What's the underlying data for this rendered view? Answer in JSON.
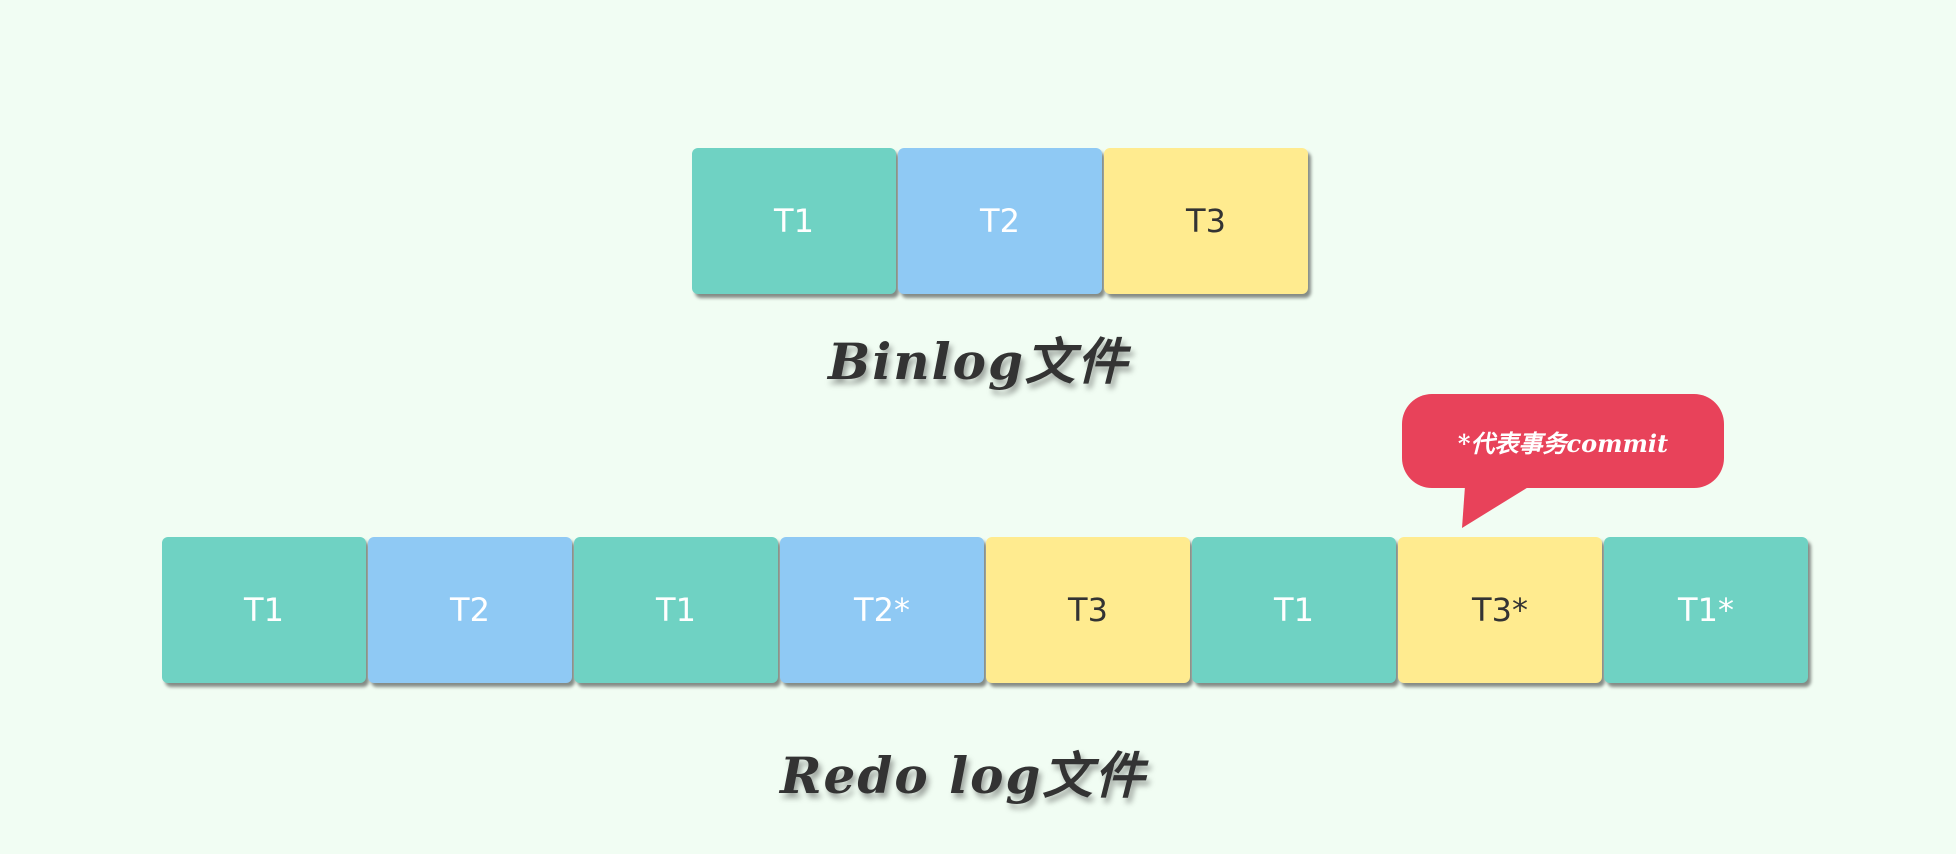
{
  "binlog": {
    "blocks": [
      {
        "label": "T1",
        "color": "#6fd2c3"
      },
      {
        "label": "T2",
        "color": "#8fc9f4"
      },
      {
        "label": "T3",
        "color": "#ffeb8f"
      }
    ],
    "caption": "Binlog文件"
  },
  "redo": {
    "blocks": [
      {
        "label": "T1",
        "color": "#6fd2c3"
      },
      {
        "label": "T2",
        "color": "#8fc9f4"
      },
      {
        "label": "T1",
        "color": "#6fd2c3"
      },
      {
        "label": "T2*",
        "color": "#8fc9f4"
      },
      {
        "label": "T3",
        "color": "#ffeb8f"
      },
      {
        "label": "T1",
        "color": "#6fd2c3"
      },
      {
        "label": "T3*",
        "color": "#ffeb8f"
      },
      {
        "label": "T1*",
        "color": "#6fd2c3"
      }
    ],
    "caption": "Redo log文件"
  },
  "callout": {
    "text": "*代表事务commit",
    "color": "#e8425a"
  },
  "colors": {
    "background": "#f1fdf3",
    "t1": "#6fd2c3",
    "t2": "#8fc9f4",
    "t3": "#ffeb8f"
  }
}
